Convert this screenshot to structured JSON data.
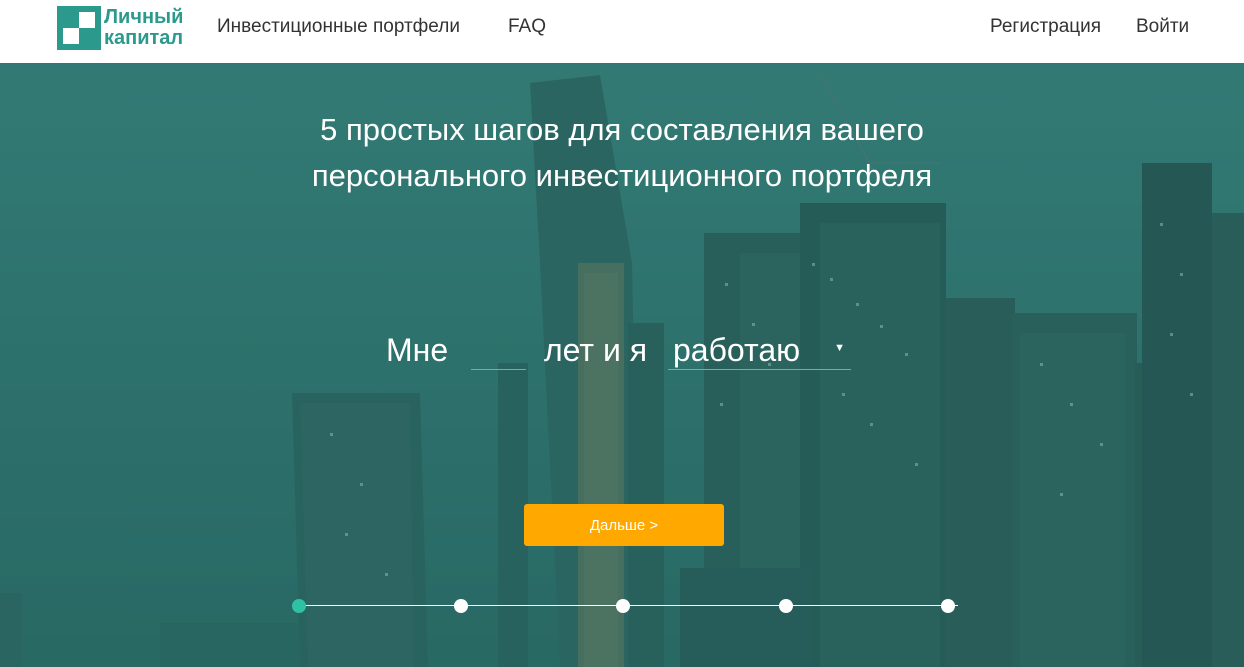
{
  "header": {
    "logo": {
      "line1": "Личный",
      "line2": "капитал"
    },
    "nav": {
      "portfolios": "Инвестиционные портфели",
      "faq": "FAQ",
      "register": "Регистрация",
      "login": "Войти"
    }
  },
  "hero": {
    "headline": {
      "line1": "5 простых шагов для составления вашего",
      "line2": "персонального инвестиционного портфеля"
    },
    "sentence": {
      "prefix": "Мне",
      "age_value": "",
      "middle": "лет и я",
      "status_selected": "работаю"
    },
    "next_button": "Дальше >",
    "steps": {
      "total": 5,
      "current": 1
    }
  },
  "colors": {
    "brand": "#2b9a8c",
    "accent_button": "#ffa900",
    "active_step": "#2fc1a4",
    "input_underline": "#3cc7b0"
  },
  "icons": {
    "logo": "logo-mark-icon",
    "select_caret": "caret-down-icon"
  }
}
